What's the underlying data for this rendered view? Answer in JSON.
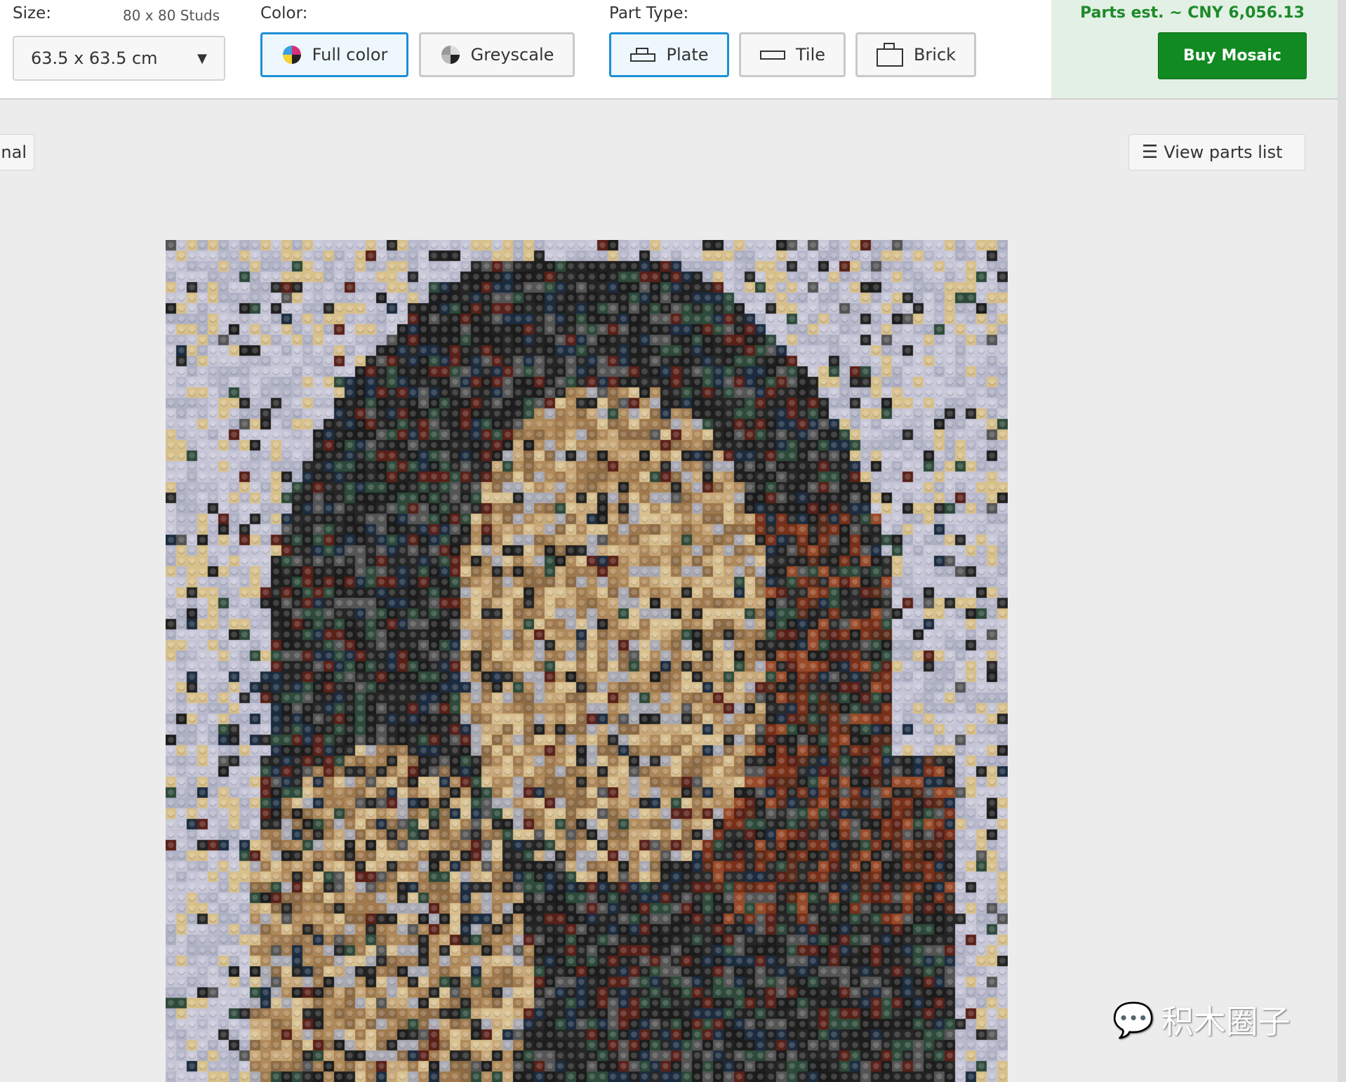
{
  "toolbar": {
    "size_label": "Size:",
    "size_studs": "80 x 80 Studs",
    "size_value": "63.5 x 63.5 cm",
    "color_label": "Color:",
    "color_options": [
      {
        "label": "Full color",
        "icon": "full-color-icon",
        "selected": true
      },
      {
        "label": "Greyscale",
        "icon": "greyscale-icon",
        "selected": false
      }
    ],
    "part_type_label": "Part Type:",
    "part_types": [
      {
        "label": "Plate",
        "icon": "plate-icon",
        "selected": true
      },
      {
        "label": "Tile",
        "icon": "tile-icon",
        "selected": false
      },
      {
        "label": "Brick",
        "icon": "brick-icon",
        "selected": false
      }
    ],
    "price": "Parts est. ~ CNY 6,056.13",
    "buy_label": "Buy Mosaic"
  },
  "main": {
    "original_button_partial": "nal",
    "view_parts_label": "View parts list"
  },
  "watermark": "积木圈子",
  "colors": {
    "accent": "#1c8fd6",
    "buy": "#118a22",
    "price": "#1d8a2a",
    "price_panel": "#e3f0e5"
  },
  "mosaic": {
    "studs": "80 x 80"
  }
}
